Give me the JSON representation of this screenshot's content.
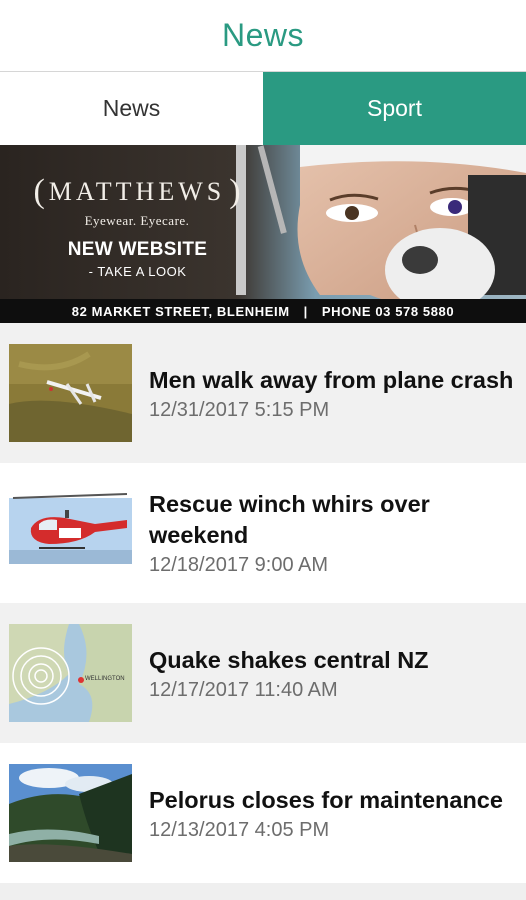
{
  "header": {
    "title": "News"
  },
  "tabs": [
    {
      "label": "News",
      "active": false
    },
    {
      "label": "Sport",
      "active": true
    }
  ],
  "banner": {
    "brand": "MATTHEWS",
    "tagline": "Eyewear. Eyecare.",
    "promo_title": "NEW WEBSITE",
    "promo_sub": "- TAKE A LOOK",
    "address": "82 MARKET STREET, BLENHEIM",
    "phone": "PHONE 03 578 5880"
  },
  "articles": [
    {
      "headline": "Men walk away from plane crash",
      "date": "12/31/2017 5:15 PM",
      "image": "plane-crash-photo"
    },
    {
      "headline": "Rescue winch whirs over weekend",
      "date": "12/18/2017 9:00 AM",
      "image": "rescue-helicopter-photo"
    },
    {
      "headline": "Quake shakes central NZ",
      "date": "12/17/2017 11:40 AM",
      "image": "quake-map-photo"
    },
    {
      "headline": "Pelorus closes for maintenance",
      "date": "12/13/2017 4:05 PM",
      "image": "pelorus-river-photo"
    }
  ],
  "map_label": "WELLINGTON",
  "colors": {
    "accent": "#2a9a82",
    "list_alt_bg": "#f1f1f1"
  }
}
